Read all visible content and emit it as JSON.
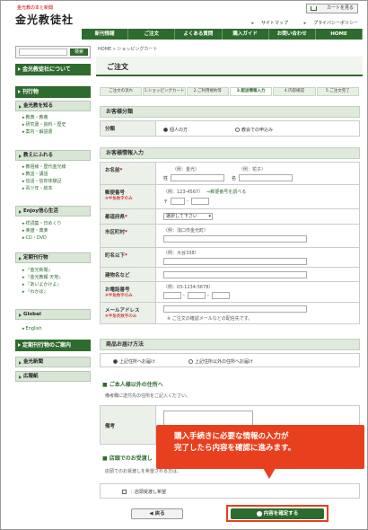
{
  "header": {
    "logo_sub": "金光教の本と新聞",
    "logo": "金光教徒社",
    "cart": "カートを見る",
    "links": [
      "サイトマップ",
      "プライバシーポリシー"
    ]
  },
  "gnav": [
    "新刊情報",
    "ご注文",
    "よくある質問",
    "購入ガイド",
    "お問い合わせ",
    "HOME"
  ],
  "sidebar": {
    "search_button": "検索",
    "about": "金光教徒社について",
    "publications": "刊行物",
    "cat1": "金光教を知る",
    "cat1_items": [
      "教典・教義",
      "研究書・資料・歴史",
      "案内・解説書"
    ],
    "cat2": "教えにふれる",
    "cat2_items": [
      "教祖様・歴代金光様",
      "教話・講話",
      "信話・信仰体験記",
      "青少年・絵本"
    ],
    "cat3": "Enjoy信心生活",
    "cat3_items": [
      "祥詞集・日めくり",
      "楽譜・典楽",
      "CD・DVD"
    ],
    "cat4": "定期刊行物",
    "cat4_items": [
      "『金光新聞』",
      "『金光教報 天地』",
      "『あいよかけよ』",
      "『わかば』"
    ],
    "global": "Global",
    "global_items": [
      "English"
    ],
    "periodicals": "定期刊行物のご案内",
    "links": [
      "金光新聞",
      "広報紙"
    ]
  },
  "breadcrumb": "HOME » ショッピングカート",
  "page_title": "ご注文",
  "steps": [
    "ご注文の流れ",
    "1.ショッピングカート",
    "2.ご利用規約等",
    "3.配送情報入力",
    "4.内容確認",
    "5.ご注文完了"
  ],
  "sections": {
    "category": "お客様分類",
    "info": "お客様情報入力",
    "delivery": "商品お届け方法",
    "other": "ご本人様以外の住所へ",
    "store": "店頭でのお受渡し"
  },
  "category": {
    "label": "分類",
    "opt1": "個人の方",
    "opt2": "教会での申込み"
  },
  "form": {
    "name": {
      "label": "お名前",
      "req": "*",
      "hint_sei": "（例：金光）",
      "hint_mei": "（例：花子）",
      "sei": "姓",
      "mei": "名"
    },
    "zip": {
      "label": "郵便番号",
      "note": "※半角数字のみ",
      "hint": "（例：123-4567）",
      "link": "郵便番号を調べる",
      "prefix": "〒"
    },
    "pref": {
      "label": "都道府県",
      "req": "*",
      "select": "選択して下さい"
    },
    "city": {
      "label": "市区町村",
      "req": "*",
      "hint": "（例：浅口市金光町）"
    },
    "street": {
      "label": "町名以下",
      "req": "*",
      "hint": "（例：大谷338）"
    },
    "building": {
      "label": "建物名など"
    },
    "tel": {
      "label": "お電話番号",
      "note": "※半角数字のみ",
      "hint": "（例：03-1234-5678）"
    },
    "mail": {
      "label": "メールアドレス",
      "note": "※半角英数字のみ",
      "hint": "ご注文の確認メールなどの配信先です。"
    }
  },
  "delivery": {
    "opt1": "上記住所へお届け",
    "opt2": "上記住所以外の住所へお届け"
  },
  "other": {
    "desc": "備考欄に送付先の住所をご記入ください。",
    "label": "備考"
  },
  "store": {
    "desc": "店頭でのお受渡しを希望される方は、",
    "check": "店頭受渡し希望"
  },
  "callout": [
    "購入手続きに必要な情報の入力が",
    "完了したら内容を確認に進みます。"
  ],
  "buttons": {
    "back": "戻る",
    "confirm": "内容を確定する"
  },
  "colors": {
    "primary": "#2e6b2e",
    "callout": "#e8401e"
  }
}
